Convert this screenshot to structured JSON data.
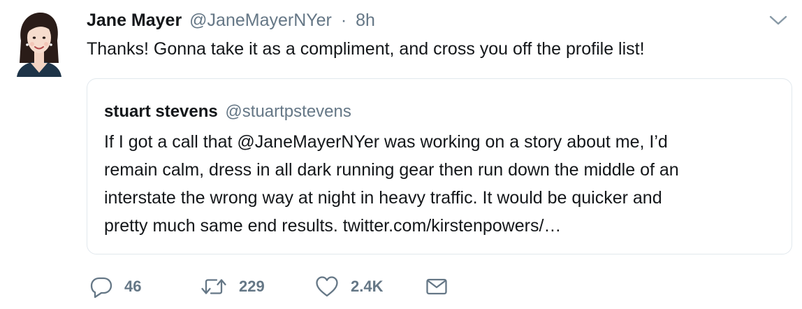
{
  "tweet": {
    "author_name": "Jane Mayer",
    "author_handle": "@JaneMayerNYer",
    "separator": "·",
    "time": "8h",
    "text": "Thanks! Gonna take it as a compliment, and cross you off the profile list!"
  },
  "quoted_tweet": {
    "author_name": "stuart stevens",
    "author_handle": "@stuartpstevens",
    "lines": [
      "If I got a call that @JaneMayerNYer was working on a story about me, I’d",
      "remain calm, dress in all dark running gear then run down the middle of an",
      "interstate the wrong way at night in heavy traffic. It would be quicker and",
      "pretty much same end results. twitter.com/kirstenpowers/…"
    ]
  },
  "actions": {
    "reply_count": "46",
    "retweet_count": "229",
    "like_count": "2.4K"
  },
  "icons": {
    "menu": "chevron-down-icon",
    "reply": "reply-icon",
    "retweet": "retweet-icon",
    "like": "heart-icon",
    "message": "envelope-icon"
  },
  "colors": {
    "text": "#14171a",
    "muted": "#657786",
    "border": "#e1e8ed"
  }
}
